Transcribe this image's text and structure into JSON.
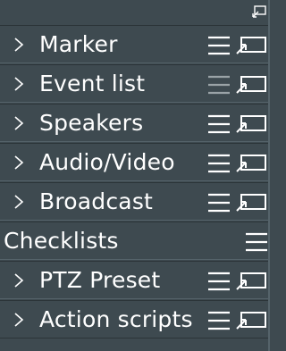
{
  "panel": {
    "rows": [
      {
        "label": "Marker",
        "type": "group",
        "menu_dimmed": false
      },
      {
        "label": "Event list",
        "type": "group",
        "menu_dimmed": true
      },
      {
        "label": "Speakers",
        "type": "group",
        "menu_dimmed": false
      },
      {
        "label": "Audio/Video",
        "type": "group",
        "menu_dimmed": false
      },
      {
        "label": "Broadcast",
        "type": "group",
        "menu_dimmed": false
      },
      {
        "label": "Checklists",
        "type": "section",
        "menu_dimmed": false
      },
      {
        "label": "PTZ Preset",
        "type": "group",
        "menu_dimmed": false
      },
      {
        "label": "Action scripts",
        "type": "group",
        "menu_dimmed": false
      }
    ]
  },
  "icons": {
    "top_right": "dock-icon",
    "expand": "chevron-right-icon",
    "menu": "hamburger-menu-icon",
    "popout": "popout-window-icon"
  },
  "colors": {
    "background": "#3e4a50",
    "text": "#ffffff",
    "icon_dimmed": "#9aa3a7",
    "divider_dark": "#2b3438",
    "divider_light": "#55636a"
  }
}
